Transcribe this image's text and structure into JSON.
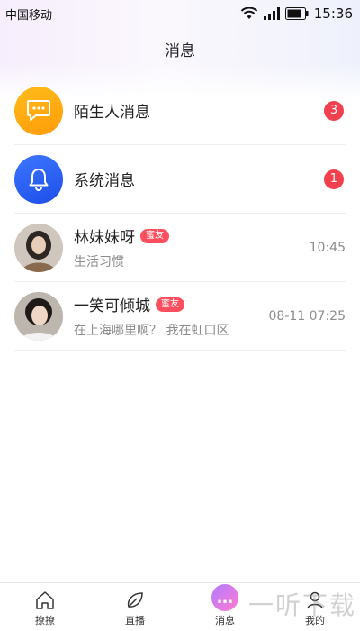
{
  "status_bar": {
    "carrier": "中国移动",
    "time": "15:36"
  },
  "header": {
    "title": "消息"
  },
  "messages": [
    {
      "name": "陌生人消息",
      "badge": "3",
      "icon": "chat-bubble-icon"
    },
    {
      "name": "系统消息",
      "badge": "1",
      "icon": "bell-icon"
    },
    {
      "name": "林妹妹呀",
      "tag": "蜜友",
      "preview": "生活习惯",
      "time": "10:45"
    },
    {
      "name": "一笑可倾城",
      "tag": "蜜友",
      "preview": "在上海哪里啊？ 我在虹口区",
      "time": "08-11 07:25"
    }
  ],
  "tabs": [
    {
      "label": "撩撩",
      "icon": "home-icon"
    },
    {
      "label": "直播",
      "icon": "leaf-icon"
    },
    {
      "label": "消息",
      "icon": "message-icon",
      "active": true
    },
    {
      "label": "我的",
      "icon": "profile-icon"
    }
  ],
  "watermark": "一听下载",
  "colors": {
    "badge": "#f2404f",
    "tag": "#ff4f5e",
    "stranger_icon": "#ffb01a",
    "system_icon": "#2a5ff0"
  }
}
